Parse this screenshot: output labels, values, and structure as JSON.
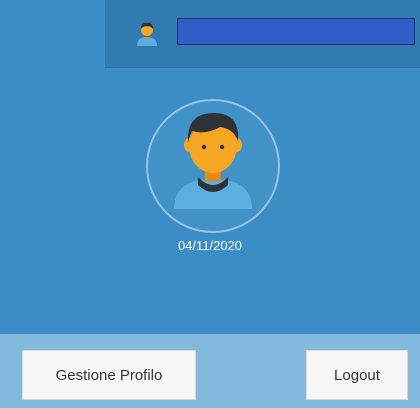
{
  "header": {
    "user_icon": "user-avatar-icon"
  },
  "profile": {
    "avatar_icon": "user-avatar-icon",
    "date": "04/11/2020"
  },
  "footer": {
    "profile_button_label": "Gestione Profilo",
    "logout_button_label": "Logout"
  },
  "colors": {
    "panel_bg": "#3a8ec5",
    "topbar_bg": "#327bb0",
    "name_bar": "#2f5fc6",
    "footer_bg": "#84b9de"
  }
}
